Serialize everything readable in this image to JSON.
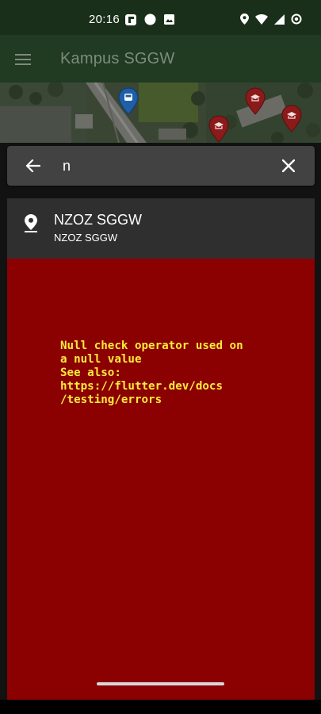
{
  "status_bar": {
    "time": "20:16",
    "left_icons": [
      "flipboard-icon",
      "circle-icon",
      "image-icon"
    ],
    "right_icons": [
      "location-icon",
      "wifi-icon",
      "signal-icon",
      "battery-icon"
    ]
  },
  "app_bar": {
    "title": "Kampus SGGW",
    "menu_icon": "menu-icon"
  },
  "search": {
    "value": "n",
    "back_icon": "arrow-back-icon",
    "clear_icon": "close-icon"
  },
  "results": [
    {
      "title": "NZOZ SGGW",
      "subtitle": "NZOZ SGGW",
      "icon": "place-icon"
    }
  ],
  "error": {
    "message": "Null check operator used on\na null value\nSee also:\nhttps://flutter.dev/docs\n/testing/errors"
  },
  "colors": {
    "status_bar": "#1a2f1a",
    "app_bar": "#213a22",
    "search_bar": "#424242",
    "result_item": "#2f2f2f",
    "error_background": "#8b0000",
    "error_text": "#ffeb3b",
    "map_pin_blue": "#1d5fa8",
    "map_pin_red": "#8b1a1a"
  }
}
